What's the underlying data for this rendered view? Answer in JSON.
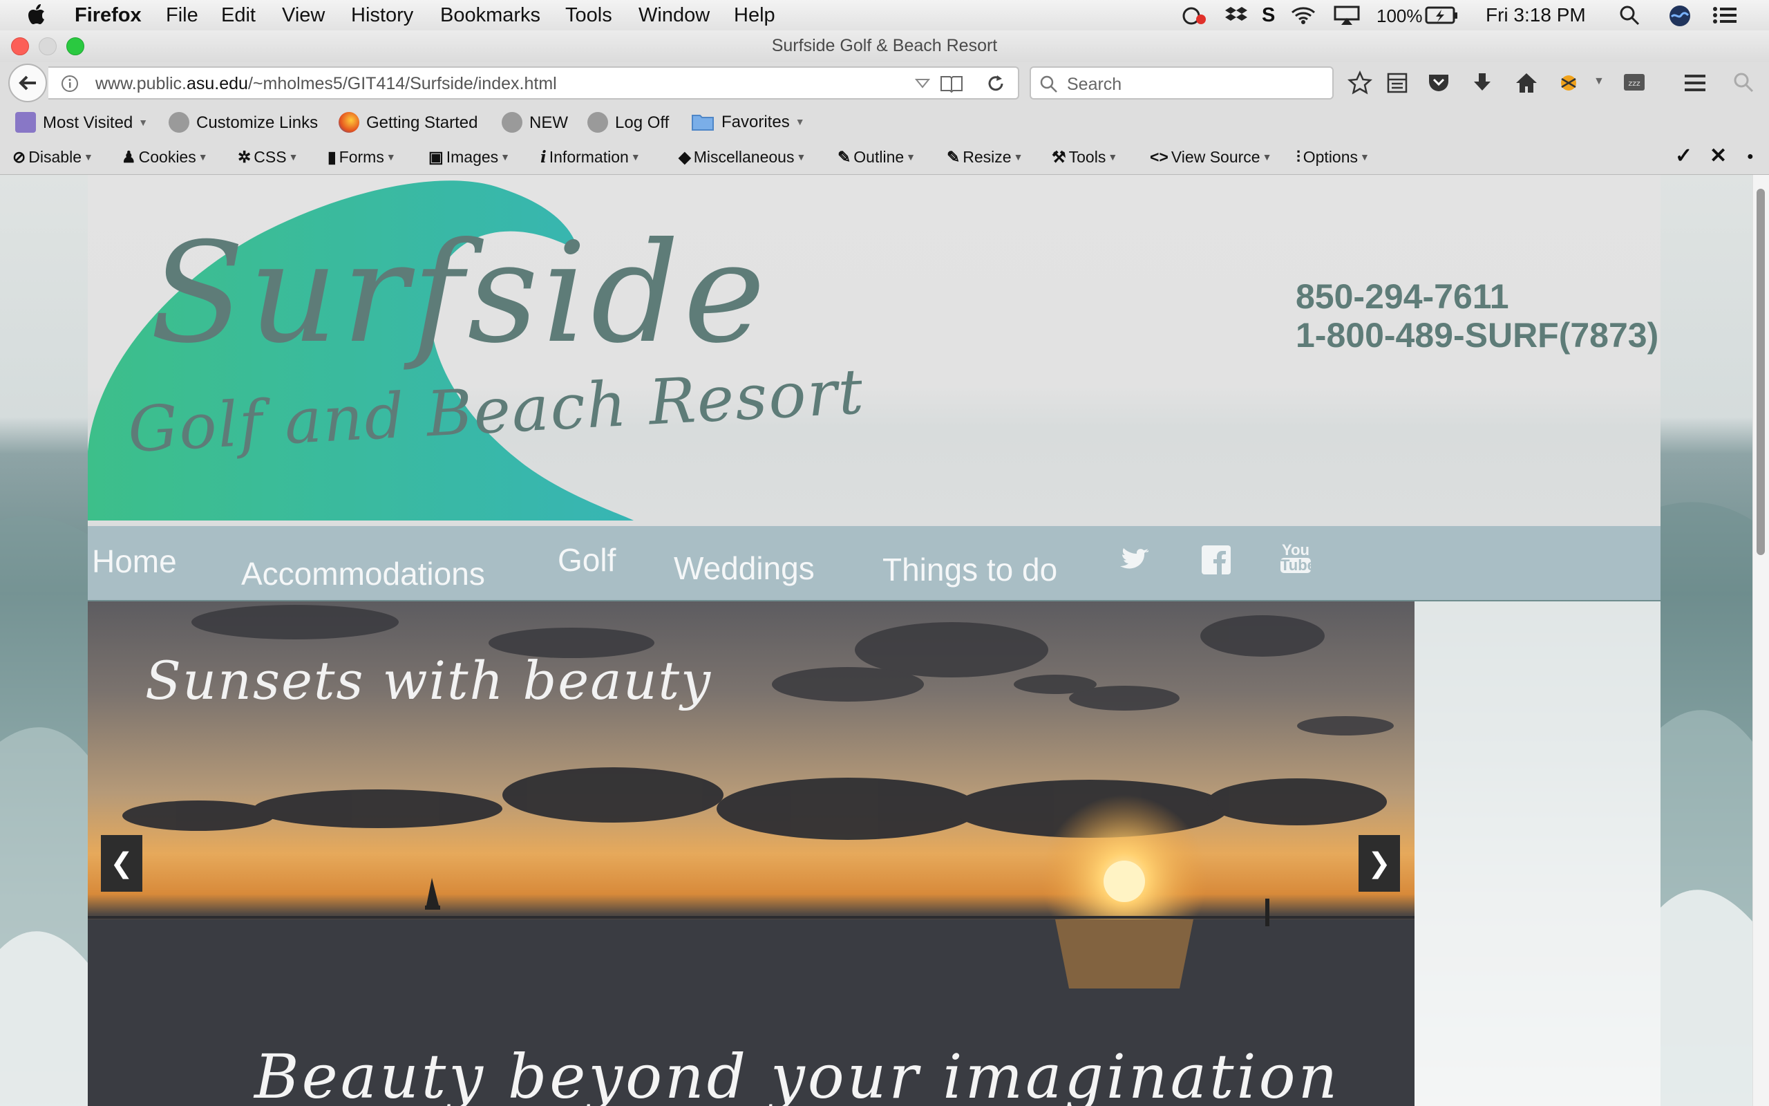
{
  "menubar": {
    "apple": "",
    "app": "Firefox",
    "items": [
      "File",
      "Edit",
      "View",
      "History",
      "Bookmarks",
      "Tools",
      "Window",
      "Help"
    ],
    "battery": "100%",
    "clock": "Fri 3:18 PM"
  },
  "window": {
    "title": "Surfside Golf & Beach Resort"
  },
  "navbar": {
    "url_prefix": "www.public.",
    "url_domain": "asu.edu",
    "url_path": "/~mholmes5/GIT414/Surfside/index.html",
    "search_placeholder": "Search"
  },
  "bookmarks": [
    "Most Visited",
    "Customize Links",
    "Getting Started",
    "NEW",
    "Log Off",
    "Favorites"
  ],
  "devtoolbar": [
    "Disable",
    "Cookies",
    "CSS",
    "Forms",
    "Images",
    "Information",
    "Miscellaneous",
    "Outline",
    "Resize",
    "Tools",
    "View Source",
    "Options"
  ],
  "site": {
    "logo_title": "Surfside",
    "logo_subtitle": "Golf and Beach Resort",
    "phone1": "850-294-7611",
    "phone2": "1-800-489-SURF(7873)",
    "nav": [
      "Home",
      "Accommodations",
      "Golf",
      "Weddings",
      "Things to do"
    ],
    "social_youtube_top": "You",
    "social_youtube_bottom": "Tube",
    "hero_caption_top": "Sunsets with beauty",
    "hero_caption_bottom": "Beauty beyond your imagination",
    "prev": "❮",
    "next": "❯"
  },
  "colors": {
    "accent_text": "#5e7c78",
    "nav_bg": "#a9bec5",
    "wave_green": "#3dbf8a",
    "wave_teal": "#37b5b4"
  }
}
